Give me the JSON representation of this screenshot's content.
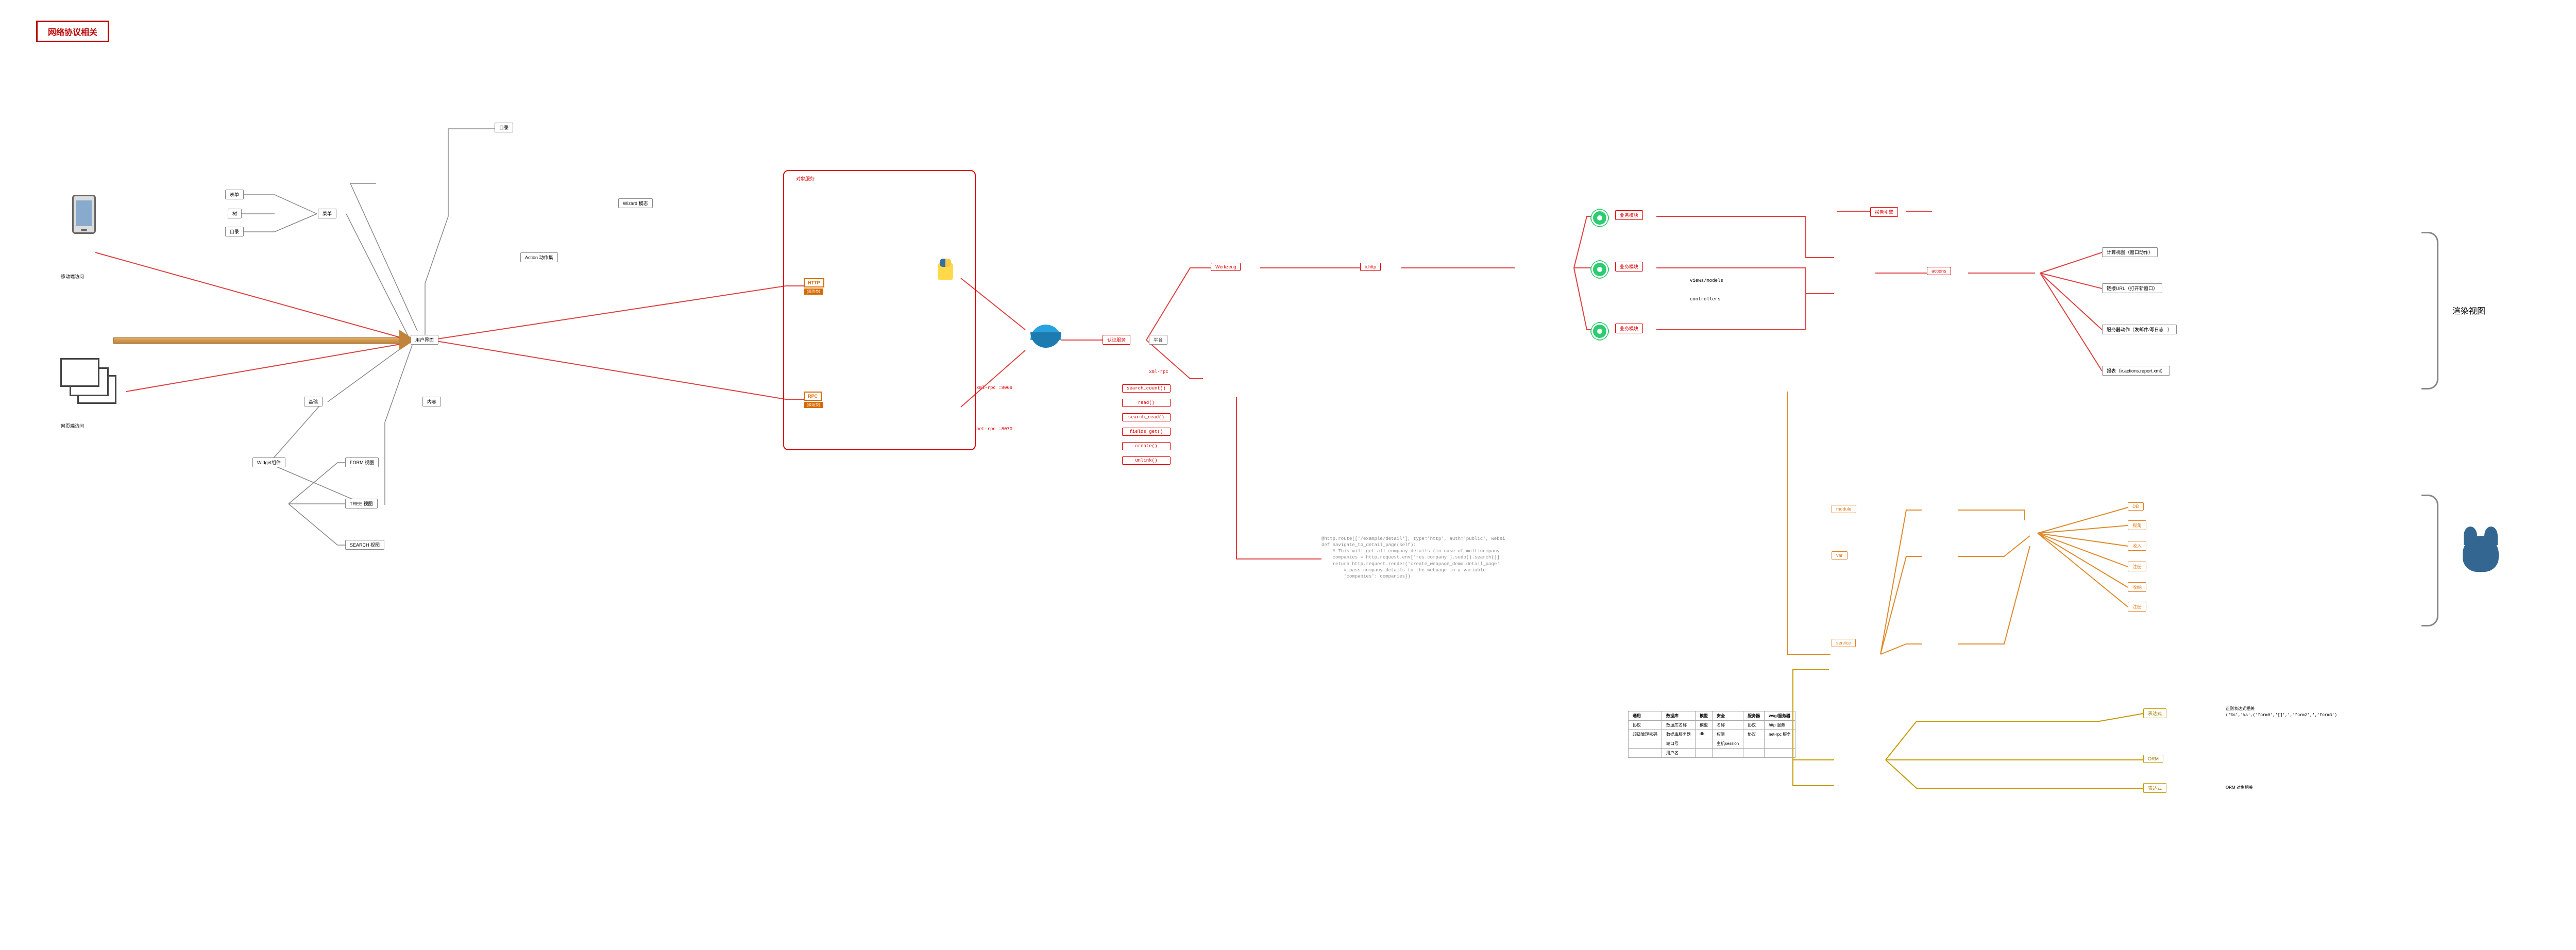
{
  "title": "网络协议相关",
  "access": {
    "mobile": "移动端访问",
    "web": "网页端访问"
  },
  "ui": {
    "user_interface": "用户界面",
    "menu": "菜单",
    "list": "表单",
    "tree": "树",
    "catalog": "目录",
    "content": "内容",
    "basic": "基础",
    "widget": "Widget组件",
    "views": {
      "form": "FORM  视图",
      "tree": "TREE  视图",
      "search": "SEARCH 视图"
    },
    "catalog2": "目录",
    "action": "Action 动作集",
    "wizard": "Wizard 模态"
  },
  "objsvc": {
    "title": "对象服务",
    "http": "HTTP",
    "http_sub": "(调用类)",
    "rpc": "RPC",
    "rpc_sub": "(调用类)",
    "xml": "xml-rpc :8069",
    "net": "net-rpc :8070"
  },
  "auth": {
    "label": "认证服务",
    "platform": "平台",
    "xmlrpc": "xml-rpc"
  },
  "flow": {
    "werkzeug": "Werkzeug",
    "irhttp": "ir.http"
  },
  "orm": {
    "boxes": [
      "search_count()",
      "read()",
      "search_read()",
      "fields_get()",
      "create()",
      "unlink()"
    ]
  },
  "biz": {
    "m1": "业务模块",
    "m2": "业务模块",
    "m3": "业务模块",
    "views": "views/models",
    "controllers": "controllers"
  },
  "actions": {
    "engine": "报告引擎",
    "label": "actions",
    "list": [
      "计算视图（窗口动作）",
      "链接URL（打开新窗口）",
      "服务器动作（发邮件/写日志...）",
      "报表（ir.actions.report.xml）"
    ]
  },
  "render": "渲染视图",
  "mvc": {
    "module": "module",
    "var": "var",
    "service": "service",
    "orm_label": "ORM",
    "items": [
      "DB",
      "视角",
      "收入",
      "注册",
      "收纳",
      "注册"
    ],
    "expr": "表达式",
    "orm_note": "ORM 对象相关",
    "expr_note1": "正则表达式相关",
    "expr_note2": "('%s','%s',('form0','[]',','form2',','form3')"
  },
  "code": "@http.route(['/example/detail'], type='http', auth='public', websi\ndef navigate_to_detail_page(self):\n    # This will get all company details (in case of multicompany\n    companies = http.request.env['res.company'].sudo().search([]\n    return http.request.render('create_webpage_demo.detail_page'\n        # pass company details to the webpage in a variable\n        'companies': companies})",
  "cfg": {
    "headers": [
      "通用",
      "数据库",
      "模型",
      "安全",
      "服务器",
      "wsgi服务器"
    ],
    "r1": [
      "协议",
      "数据库名称",
      "模型",
      "名称",
      "协议",
      "http 服务",
      "",
      ""
    ],
    "r2": [
      "超级管理密码",
      "数据库服务器",
      "db",
      "权限",
      "协议",
      "net-rpc 服务",
      "",
      ""
    ],
    "r3": [
      "",
      "端口号",
      "",
      "主机session",
      "",
      "",
      "",
      ""
    ],
    "r4": [
      "",
      "用户名",
      "",
      "",
      "",
      "",
      "",
      ""
    ]
  }
}
